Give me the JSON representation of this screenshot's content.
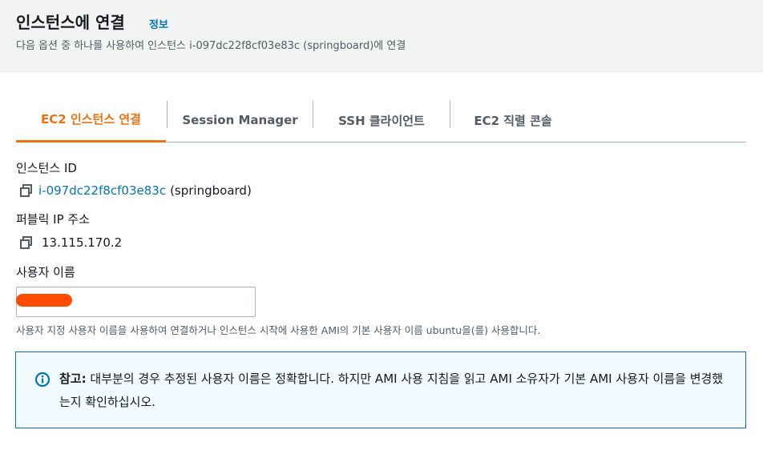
{
  "header": {
    "title": "인스턴스에 연결",
    "info_link": "정보",
    "subtitle": "다음 옵션 중 하나를 사용하여 인스턴스 i-097dc22f8cf03e83c (springboard)에 연결"
  },
  "tabs": [
    {
      "label": "EC2 인스턴스 연결",
      "active": true
    },
    {
      "label": "Session Manager",
      "active": false
    },
    {
      "label": "SSH 클라이언트",
      "active": false
    },
    {
      "label": "EC2 직렬 콘솔",
      "active": false
    }
  ],
  "instance": {
    "label": "인스턴스 ID",
    "id_link": "i-097dc22f8cf03e83c",
    "name_suffix": "(springboard)"
  },
  "public_ip": {
    "label": "퍼블릭 IP 주소",
    "value": "13.115.170.2"
  },
  "username": {
    "label": "사용자 이름",
    "value": "",
    "hint": "사용자 지정 사용자 이름을 사용하여 연결하거나 인스턴스 시작에 사용한 AMI의 기본 사용자 이름 ubuntu을(를) 사용합니다."
  },
  "alert": {
    "title": "참고:",
    "body": "대부분의 경우 추정된 사용자 이름은 정확합니다. 하지만 AMI 사용 지침을 읽고 AMI 소유자가 기본 AMI 사용자 이름을 변경했는지 확인하십시오."
  },
  "colors": {
    "accent": "#ec7211",
    "link": "#0073bb",
    "redaction": "#ff4b00",
    "alert_bg": "#f1faff"
  },
  "icons": [
    "copy-icon",
    "info-circle-icon"
  ]
}
